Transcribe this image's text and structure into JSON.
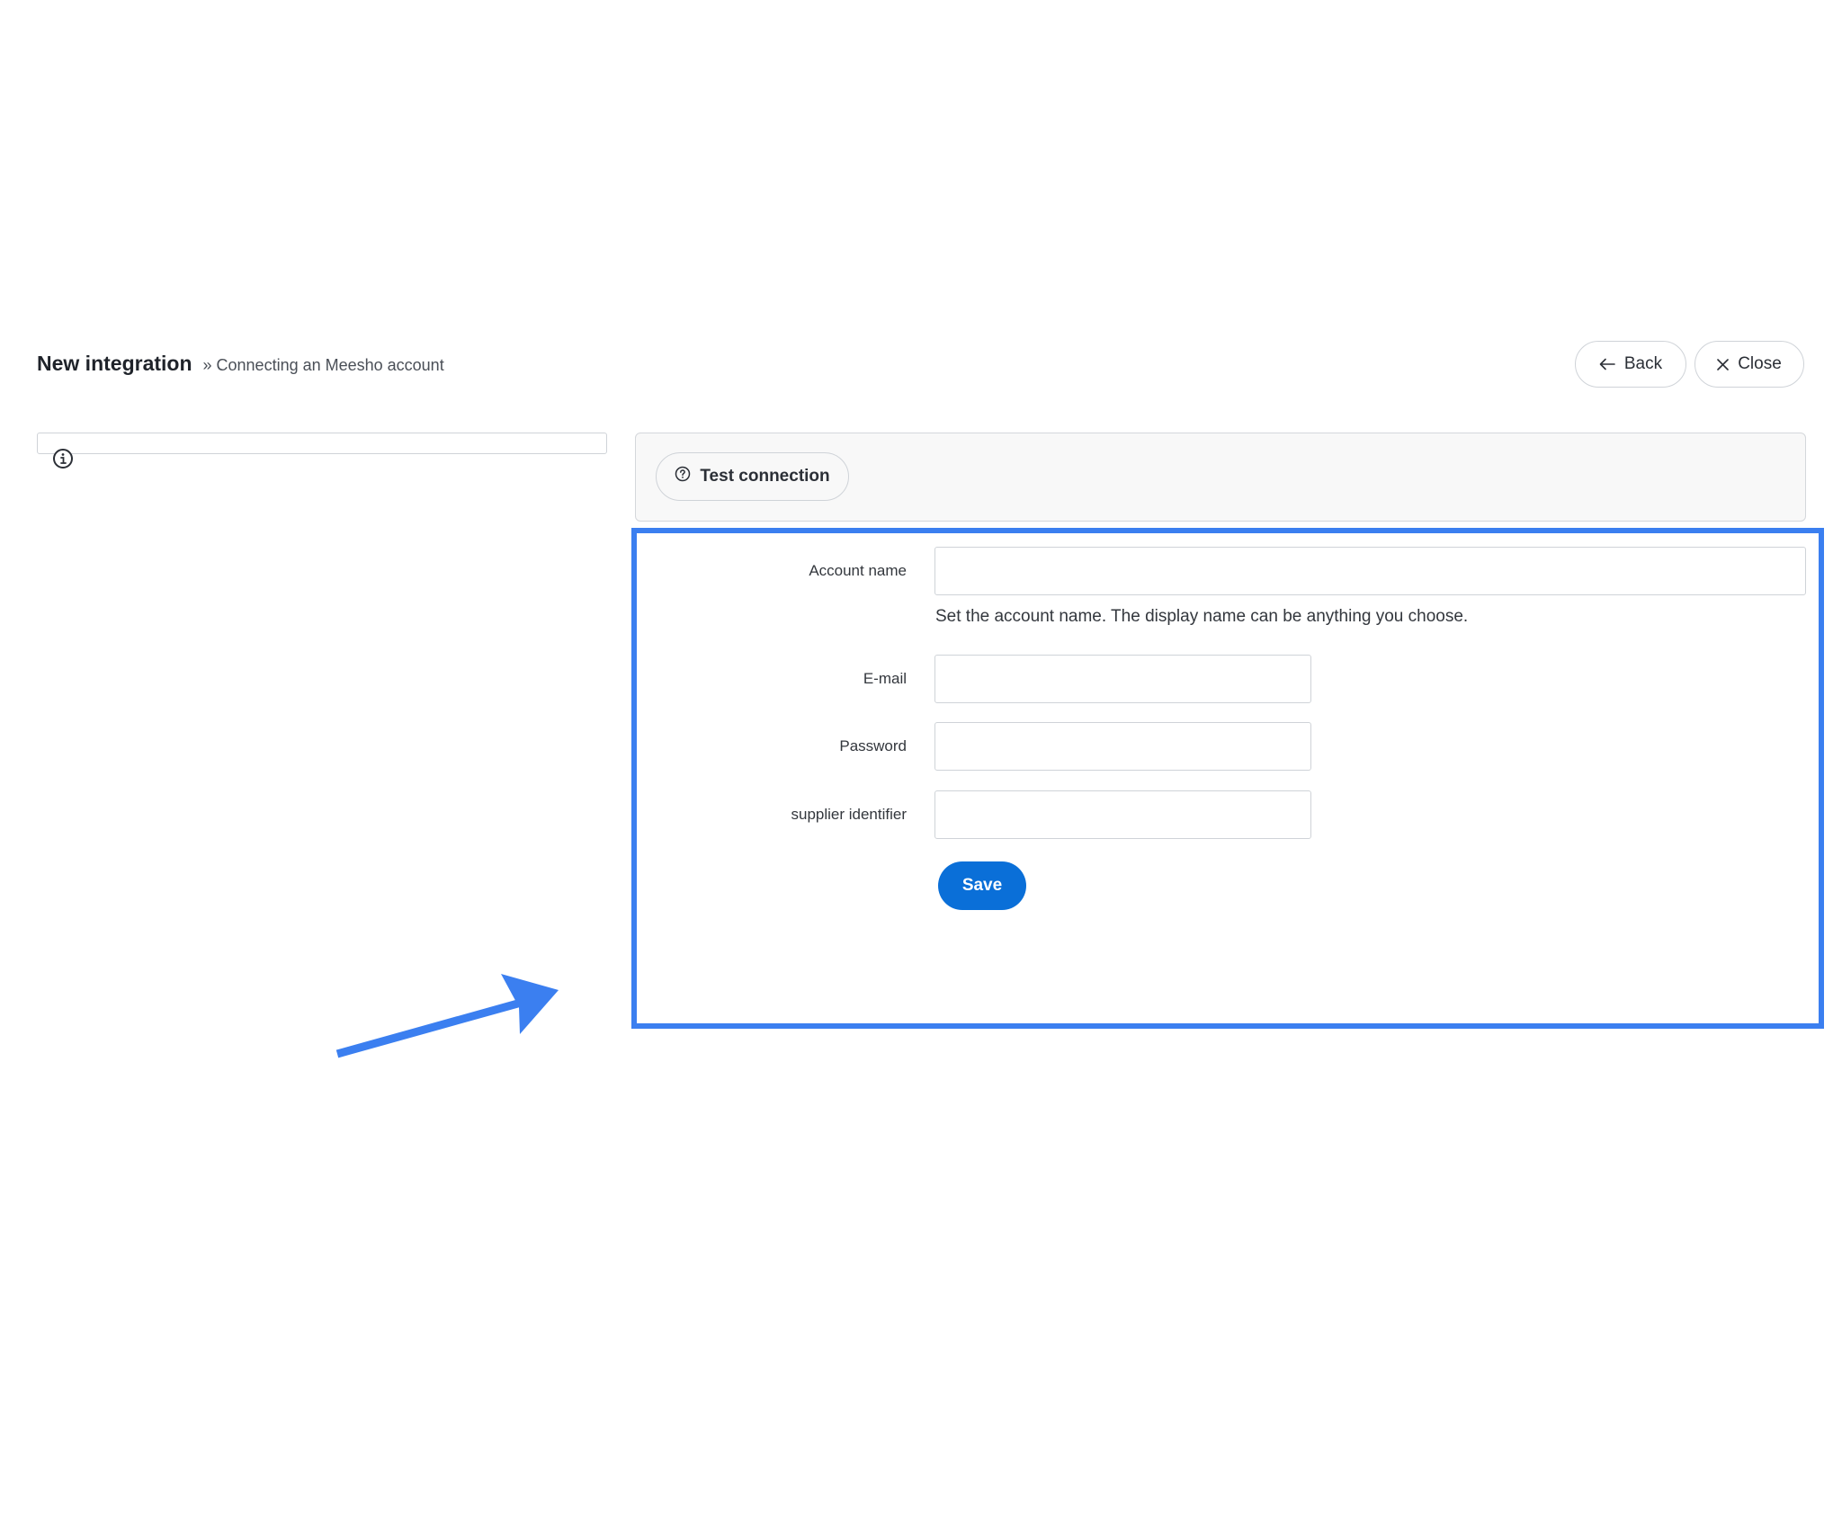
{
  "header": {
    "title": "New integration",
    "subtitle": "» Connecting an Meesho account"
  },
  "actions": {
    "back_label": "Back",
    "close_label": "Close"
  },
  "toolbar": {
    "test_connection_label": "Test connection"
  },
  "form": {
    "account_name": {
      "label": "Account name",
      "value": "",
      "help": "Set the account name. The display name can be anything you choose."
    },
    "email": {
      "label": "E-mail",
      "value": ""
    },
    "password": {
      "label": "Password",
      "value": ""
    },
    "supplier_identifier": {
      "label": "supplier identifier",
      "value": ""
    },
    "save_label": "Save"
  },
  "colors": {
    "accent": "#0a6fd8",
    "annotation": "#3b7ff0"
  },
  "icons": {
    "back": "arrow-left-icon",
    "close": "close-icon",
    "test": "question-circle-icon",
    "info": "info-circle-icon"
  }
}
